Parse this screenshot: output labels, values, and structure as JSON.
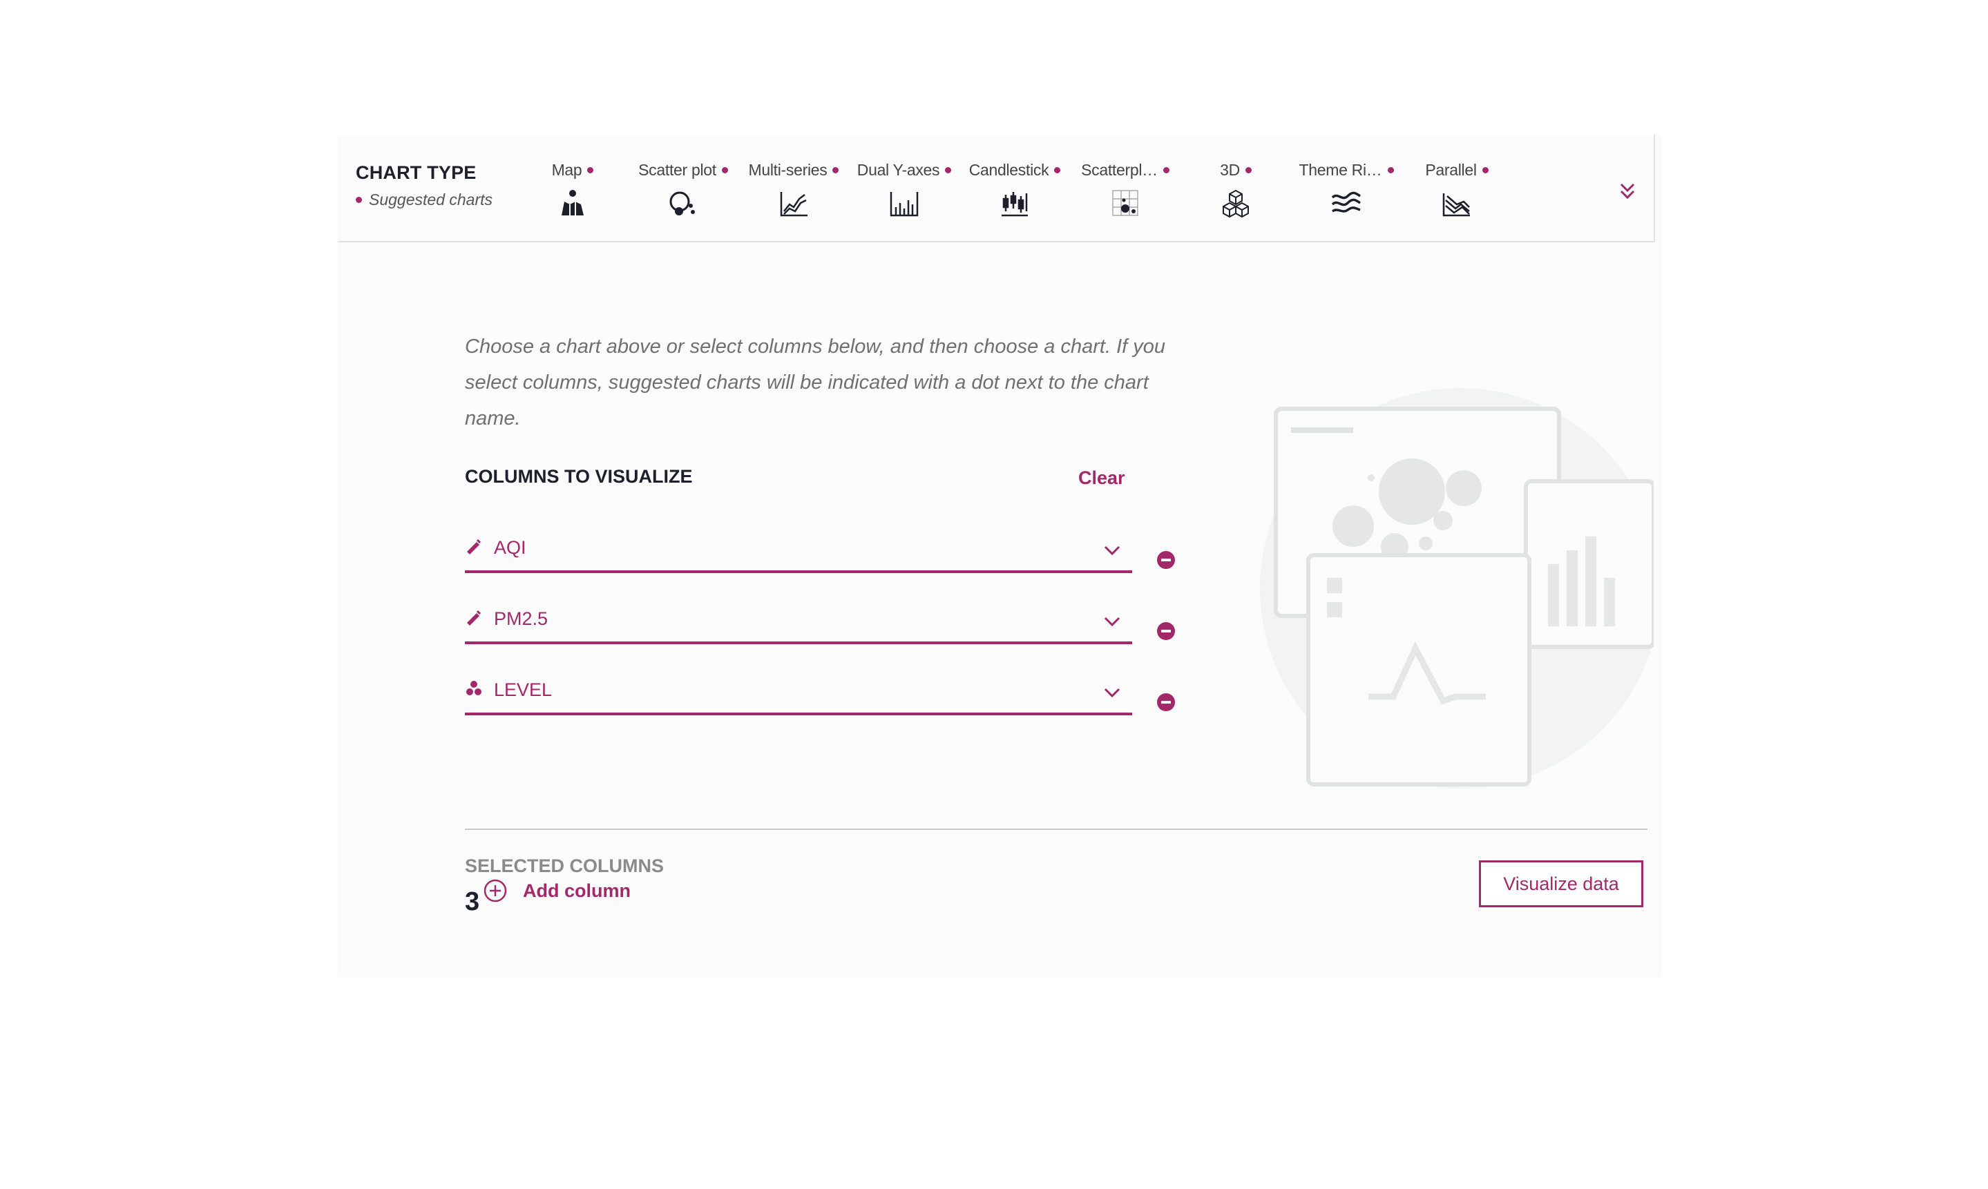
{
  "chart_type": {
    "title": "CHART TYPE",
    "suggested_label": "Suggested charts",
    "items": [
      {
        "label": "Map",
        "icon": "map-icon",
        "suggested": true
      },
      {
        "label": "Scatter plot",
        "icon": "scatter-plot-icon",
        "suggested": true
      },
      {
        "label": "Multi-series",
        "icon": "multi-series-icon",
        "suggested": true
      },
      {
        "label": "Dual Y-axes",
        "icon": "dual-y-axes-icon",
        "suggested": true
      },
      {
        "label": "Candlestick",
        "icon": "candlestick-icon",
        "suggested": true
      },
      {
        "label": "Scatterpl…",
        "icon": "scatterplot-matrix-icon",
        "suggested": true
      },
      {
        "label": "3D",
        "icon": "3d-icon",
        "suggested": true
      },
      {
        "label": "Theme Ri…",
        "icon": "theme-river-icon",
        "suggested": true
      },
      {
        "label": "Parallel",
        "icon": "parallel-icon",
        "suggested": true
      }
    ],
    "expand_icon": "double-chevron-down-icon"
  },
  "main": {
    "intro": "Choose a chart above or select columns below, and then choose a chart. If you select columns, suggested charts will be indicated with a dot next to the chart name.",
    "columns_title": "COLUMNS TO VISUALIZE",
    "clear_label": "Clear",
    "columns": [
      {
        "value": "AQI",
        "type_icon": "ruler-icon"
      },
      {
        "value": "PM2.5",
        "type_icon": "ruler-icon"
      },
      {
        "value": "LEVEL",
        "type_icon": "category-icon"
      }
    ],
    "add_column_label": "Add column",
    "selected_title": "SELECTED COLUMNS",
    "selected_count": "3",
    "visualize_label": "Visualize data"
  },
  "colors": {
    "accent": "#a3286a",
    "text_dark": "#1f1f2b",
    "text_muted": "#707070",
    "panel_bg": "#fbfbfb"
  }
}
